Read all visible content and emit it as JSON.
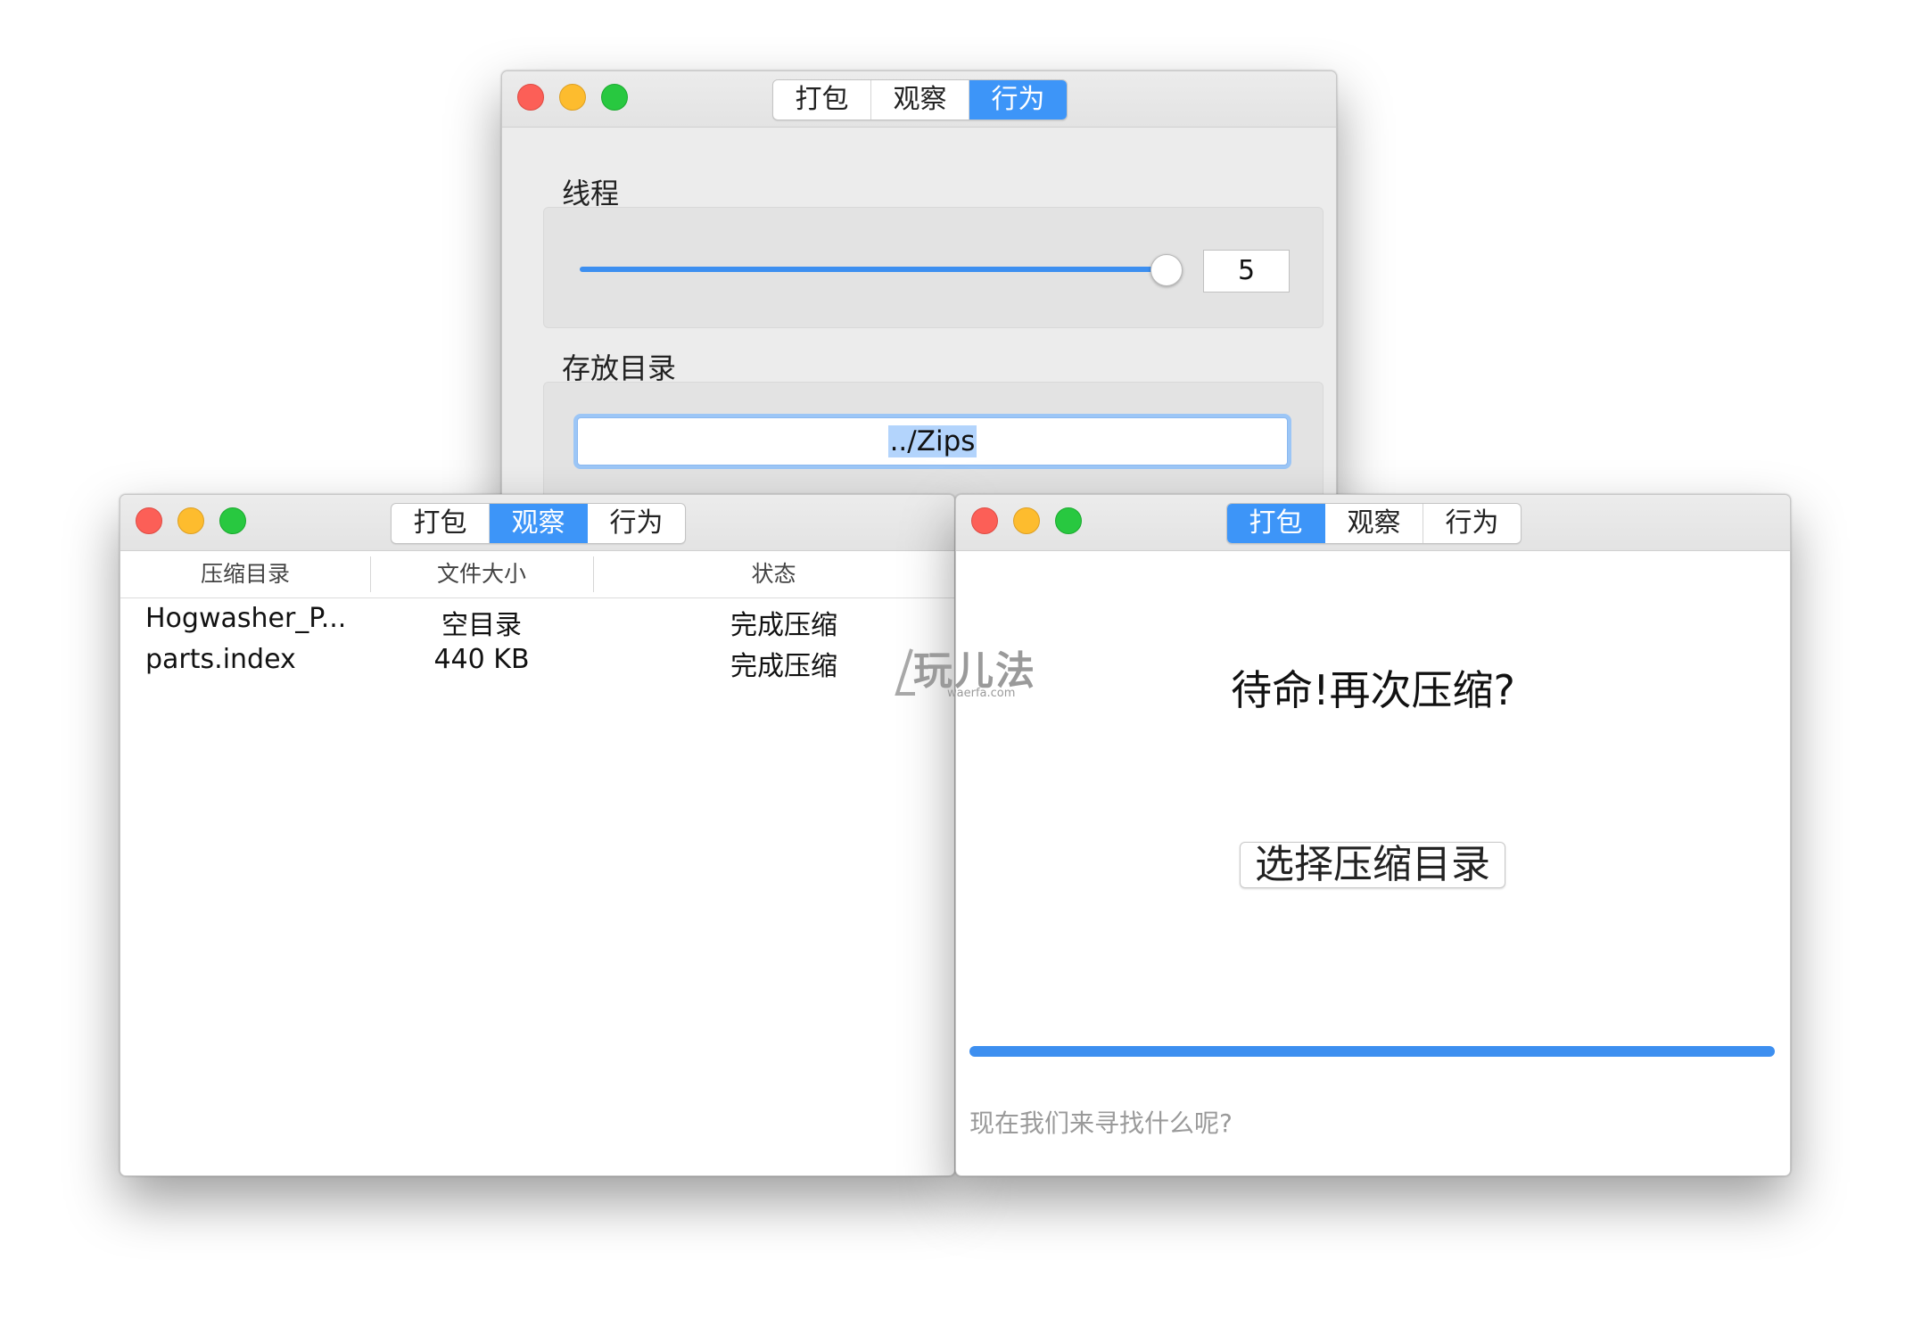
{
  "tabs": [
    "打包",
    "观察",
    "行为"
  ],
  "behavior_window": {
    "threads_label": "线程",
    "threads_value": "5",
    "threads_fraction": 0.97,
    "storage_label": "存放目录",
    "storage_path": "../Zips"
  },
  "observe_window": {
    "columns": [
      "压缩目录",
      "文件大小",
      "状态"
    ],
    "rows": [
      {
        "name": "Hogwasher_P...",
        "size": "空目录",
        "status": "完成压缩"
      },
      {
        "name": "parts.index",
        "size": "440 KB",
        "status": "完成压缩"
      }
    ]
  },
  "pack_window": {
    "heading": "待命!再次压缩?",
    "choose_button": "选择压缩目录",
    "progress_fraction": 1.0,
    "hint": "现在我们来寻找什么呢?"
  },
  "watermark": {
    "brand": "玩儿法",
    "site": "waerfa.com"
  },
  "colors": {
    "accent": "#3d95f8",
    "close": "#fc5f57",
    "minimize": "#fdbc2e",
    "zoom": "#28c840"
  }
}
